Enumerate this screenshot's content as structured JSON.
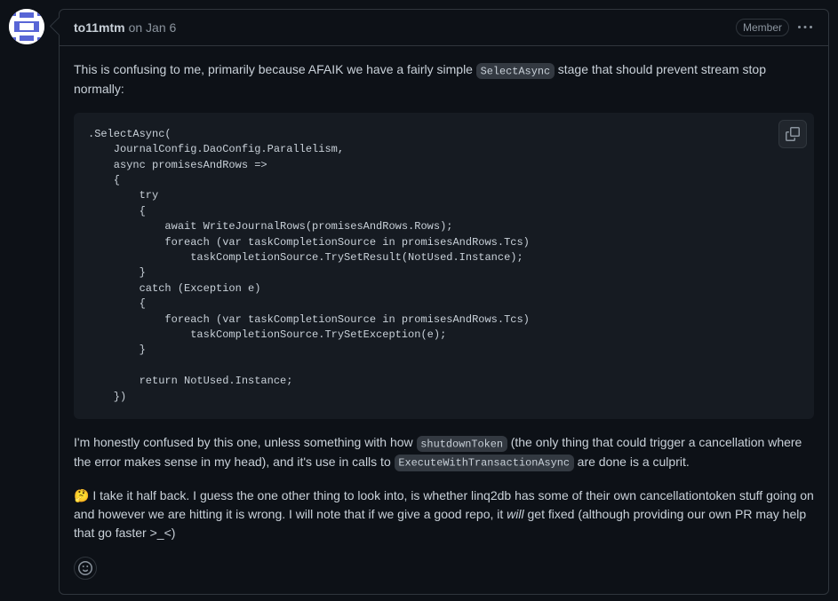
{
  "comment": {
    "author": "to11mtm",
    "timestamp": "on Jan 6",
    "badge": "Member",
    "body": {
      "p1_a": "This is confusing to me, primarily because AFAIK we have a fairly simple ",
      "p1_code": "SelectAsync",
      "p1_b": " stage that should prevent stream stop normally:",
      "code": ".SelectAsync(\n    JournalConfig.DaoConfig.Parallelism,\n    async promisesAndRows =>\n    {\n        try\n        {\n            await WriteJournalRows(promisesAndRows.Rows);\n            foreach (var taskCompletionSource in promisesAndRows.Tcs)\n                taskCompletionSource.TrySetResult(NotUsed.Instance);\n        }\n        catch (Exception e)\n        {\n            foreach (var taskCompletionSource in promisesAndRows.Tcs)\n                taskCompletionSource.TrySetException(e);\n        }\n\n        return NotUsed.Instance;\n    })",
      "p2_a": "I'm honestly confused by this one, unless something with how ",
      "p2_code1": "shutdownToken",
      "p2_b": " (the only thing that could trigger a cancellation where the error makes sense in my head), and it's use in calls to ",
      "p2_code2": "ExecuteWithTransactionAsync",
      "p2_c": " are done is a culprit.",
      "p3_emoji": "🤔",
      "p3_a": " I take it half back. I guess the one other thing to look into, is whether linq2db has some of their own cancellationtoken stuff going on and however we are hitting it is wrong. I will note that if we give a good repo, it ",
      "p3_em": "will",
      "p3_b": " get fixed (although providing our own PR may help that go faster >_<)"
    }
  }
}
